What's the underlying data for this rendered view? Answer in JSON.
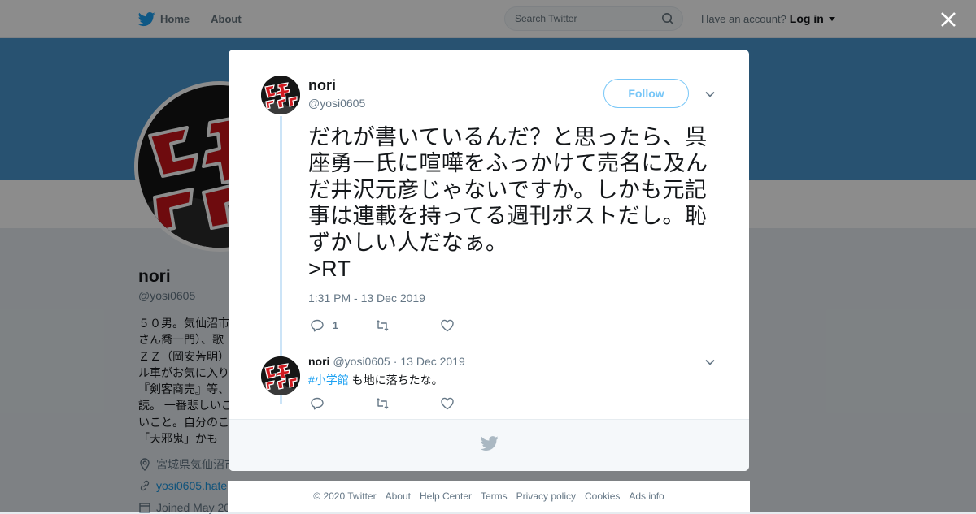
{
  "nav": {
    "home": "Home",
    "about": "About",
    "search_placeholder": "Search Twitter",
    "have_account": "Have an account?",
    "login": "Log in"
  },
  "profile": {
    "name": "nori",
    "handle": "@yosi0605",
    "bio_visible": "５０男。気仙沼市\nさん喬一門）、歌\nＺＺ（岡安芳明）\nル車がお気に入り\n『剣客商売』等、\n読。 一番悲しいこ\nいこと。自分のこ\n「天邪鬼」かも",
    "location": "宮城県気仙沼市",
    "url": "yosi0605.hate",
    "joined": "Joined May 20"
  },
  "tweet": {
    "name": "nori",
    "handle": "@yosi0605",
    "follow_label": "Follow",
    "text": "だれが書いているんだ？と思ったら、呉座勇一氏に喧嘩をふっかけて売名に及んだ井沢元彦じゃないですか。しかも元記事は連載を持ってる週刊ポストだし。恥ずかしい人だなぁ。\n>RT",
    "time": "1:31 PM - 13 Dec 2019",
    "reply_count": "1"
  },
  "reply": {
    "name": "nori",
    "handle": "@yosi0605",
    "sep": "·",
    "date": "13 Dec 2019",
    "hashtag": "#小学館",
    "text": " も地に落ちたな。"
  },
  "footer": {
    "links": [
      "© 2020 Twitter",
      "About",
      "Help Center",
      "Terms",
      "Privacy policy",
      "Cookies",
      "Ads info"
    ]
  },
  "colors": {
    "twitter_blue": "#1da1f2",
    "banner": "#4a95ce",
    "thread_line": "#cce4f7"
  },
  "icons": [
    "twitter-bird-icon",
    "search-icon",
    "close-icon",
    "chevron-down-icon",
    "reply-icon",
    "retweet-icon",
    "heart-icon",
    "location-icon",
    "link-icon",
    "calendar-icon"
  ]
}
